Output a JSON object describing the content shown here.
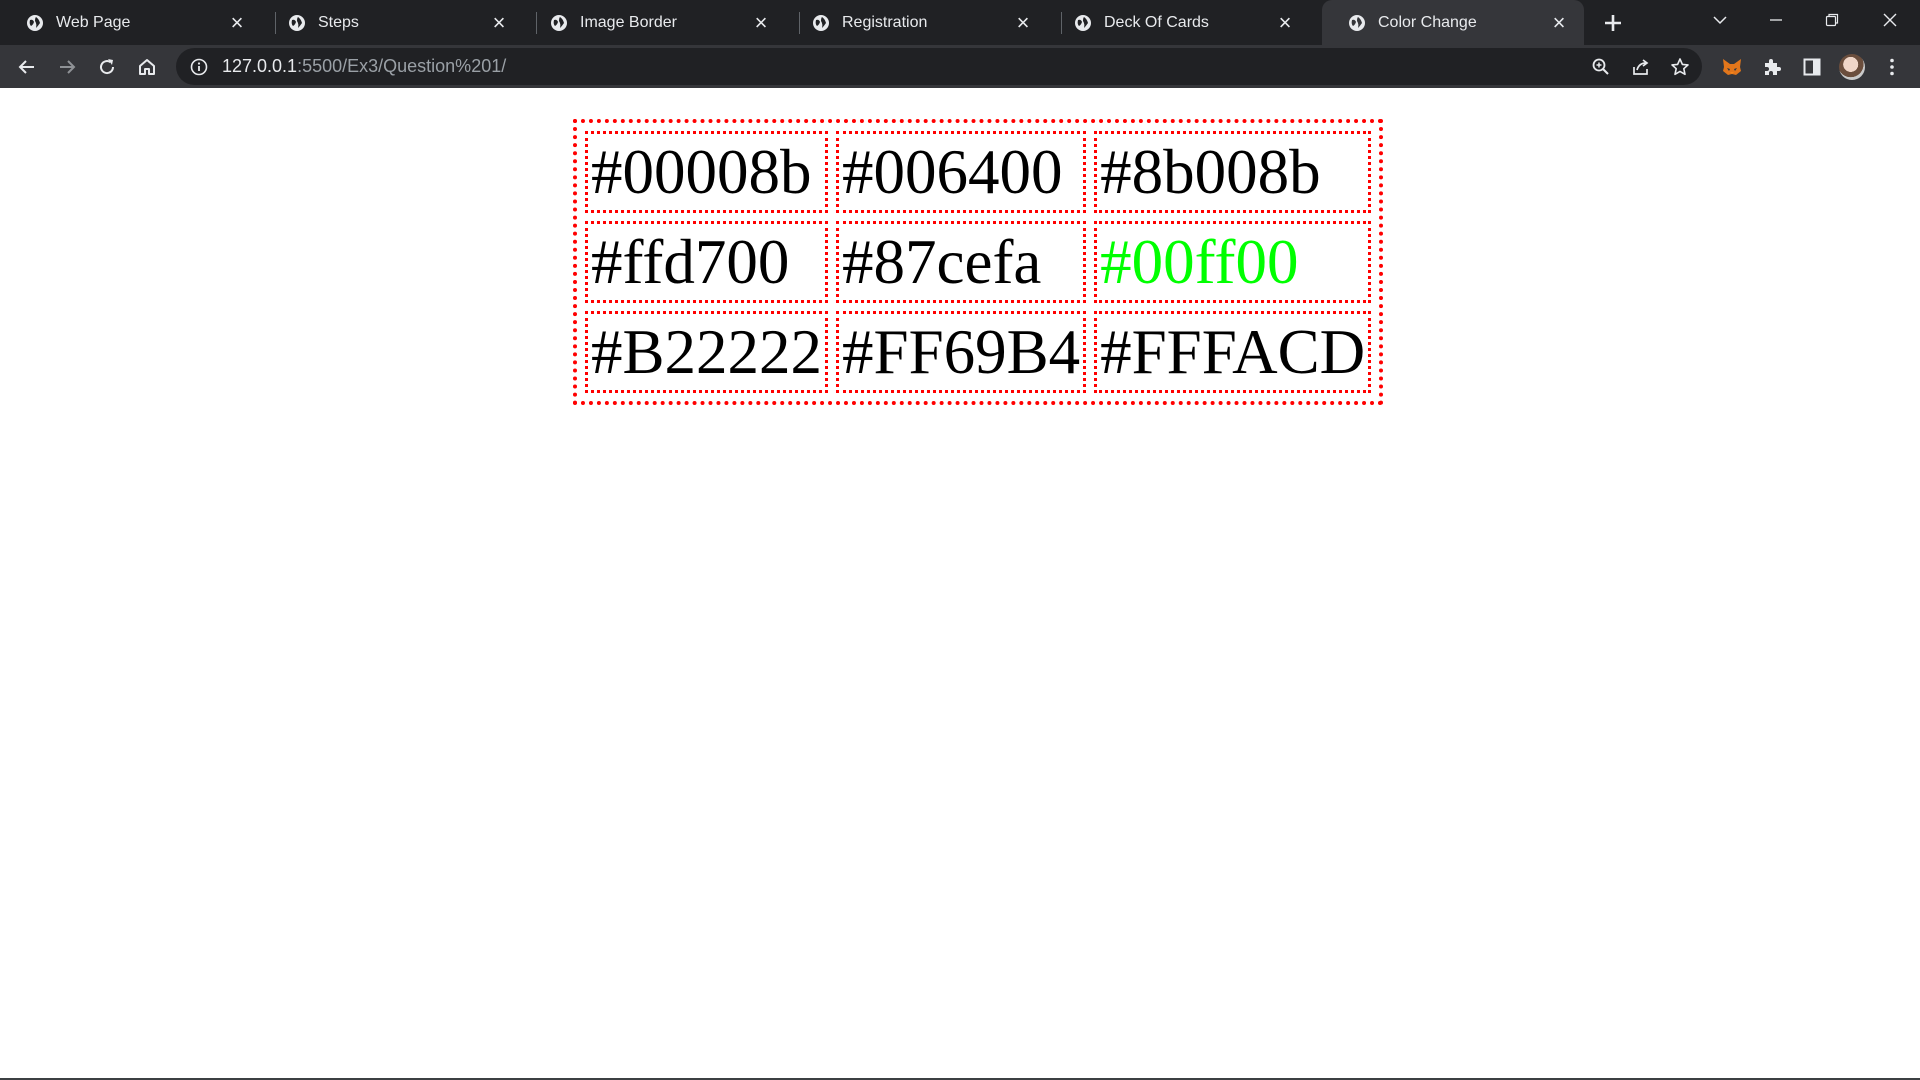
{
  "browser": {
    "tabs": [
      {
        "title": "Web Page",
        "active": false
      },
      {
        "title": "Steps",
        "active": false
      },
      {
        "title": "Image Border",
        "active": false
      },
      {
        "title": "Registration",
        "active": false
      },
      {
        "title": "Deck Of Cards",
        "active": false
      },
      {
        "title": "Color Change",
        "active": true
      }
    ],
    "address": {
      "host": "127.0.0.1",
      "rest": ":5500/Ex3/Question%201/"
    },
    "icons": {
      "tab_favicon": "globe-icon",
      "back": "arrow-left-icon",
      "forward": "arrow-right-icon",
      "reload": "reload-icon",
      "home": "home-icon",
      "site_info": "info-icon",
      "zoom": "zoom-icon",
      "share": "share-icon",
      "bookmark": "star-icon",
      "metamask": "fox-icon",
      "extensions": "puzzle-icon",
      "side_panel": "side-panel-icon",
      "profile": "avatar",
      "menu": "kebab-menu-icon"
    }
  },
  "page": {
    "table": {
      "border_color": "#ff0000",
      "rows": [
        [
          {
            "text": "#00008b",
            "color": "#000000"
          },
          {
            "text": "#006400",
            "color": "#000000"
          },
          {
            "text": "#8b008b",
            "color": "#000000"
          }
        ],
        [
          {
            "text": "#ffd700",
            "color": "#000000"
          },
          {
            "text": "#87cefa",
            "color": "#000000"
          },
          {
            "text": "#00ff00",
            "color": "#00ff00"
          }
        ],
        [
          {
            "text": "#B22222",
            "color": "#000000"
          },
          {
            "text": "#FF69B4",
            "color": "#000000"
          },
          {
            "text": "#FFFACD",
            "color": "#000000"
          }
        ]
      ]
    }
  }
}
